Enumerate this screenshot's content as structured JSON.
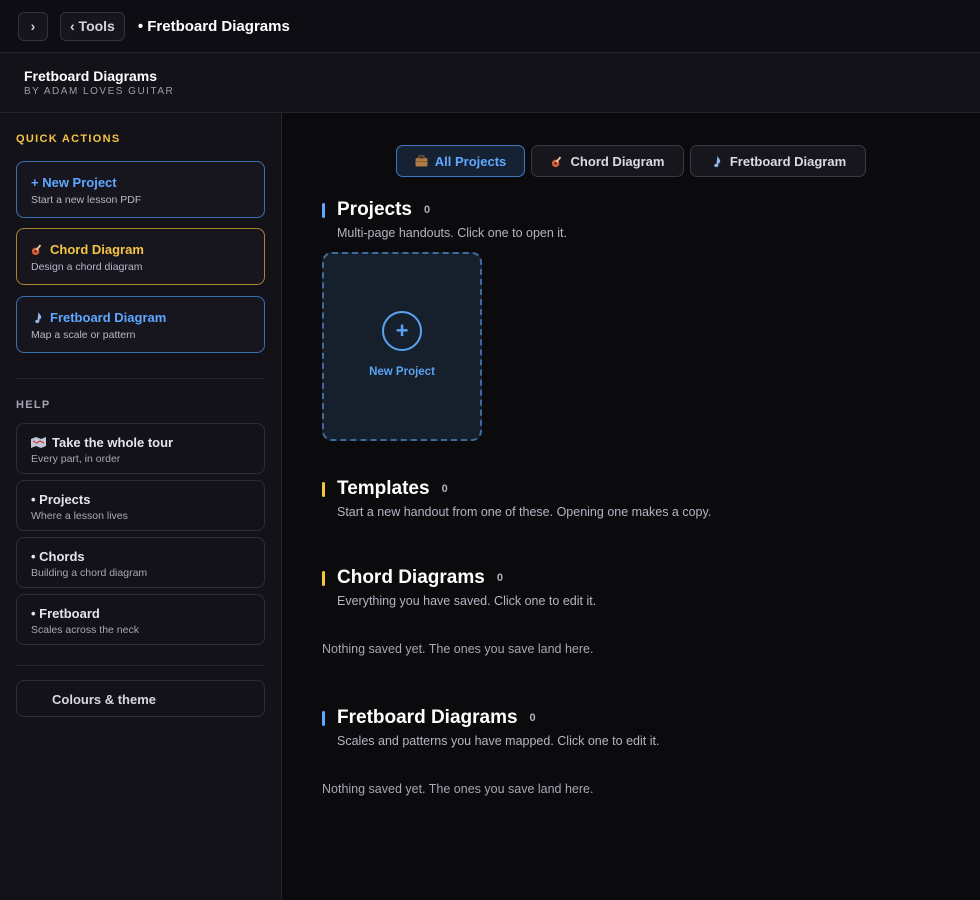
{
  "topbar": {
    "expand_label": "›",
    "tools_label": "‹ Tools",
    "title": "• Fretboard Diagrams"
  },
  "app": {
    "title": "Fretboard Diagrams",
    "subtitle": "BY ADAM LOVES GUITAR"
  },
  "sidebar": {
    "quick_actions_label": "QUICK ACTIONS",
    "quick_actions": [
      {
        "title": "+ New Project",
        "sub": "Start a new lesson PDF",
        "color": "#5ea8ff",
        "icon": ""
      },
      {
        "title": "Chord Diagram",
        "sub": "Design a chord diagram",
        "color": "#f5c542",
        "icon": "guitar-icon"
      },
      {
        "title": "Fretboard Diagram",
        "sub": "Map a scale or pattern",
        "color": "#5ea8ff",
        "icon": "music-note-icon"
      }
    ],
    "help_label": "HELP",
    "help_items": [
      {
        "title": "Take the whole tour",
        "sub": "Every part, in order",
        "icon": "map-icon"
      },
      {
        "title": "• Projects",
        "sub": "Where a lesson lives"
      },
      {
        "title": "• Chords",
        "sub": "Building a chord diagram"
      },
      {
        "title": "• Fretboard",
        "sub": "Scales across the neck"
      }
    ],
    "theme_label": "Colours & theme"
  },
  "tabs": [
    {
      "label": "All Projects",
      "icon": "briefcase-icon",
      "active": true
    },
    {
      "label": "Chord Diagram",
      "icon": "guitar-icon",
      "active": false
    },
    {
      "label": "Fretboard Diagram",
      "icon": "music-note-icon",
      "active": false
    }
  ],
  "sections": {
    "projects": {
      "title": "Projects",
      "count": "0",
      "desc": "Multi-page handouts. Click one to open it.",
      "new_label": "New Project",
      "plus": "+"
    },
    "templates": {
      "title": "Templates",
      "count": "0",
      "desc": "Start a new handout from one of these. Opening one makes a copy."
    },
    "chords": {
      "title": "Chord Diagrams",
      "count": "0",
      "desc": "Everything you have saved. Click one to edit it.",
      "empty": "Nothing saved yet. The ones you save land here."
    },
    "fretboards": {
      "title": "Fretboard Diagrams",
      "count": "0",
      "desc": "Scales and patterns you have mapped. Click one to edit it.",
      "empty": "Nothing saved yet. The ones you save land here."
    }
  },
  "colors": {
    "accent_blue": "#5ea8ff",
    "accent_yellow": "#f5c542"
  }
}
